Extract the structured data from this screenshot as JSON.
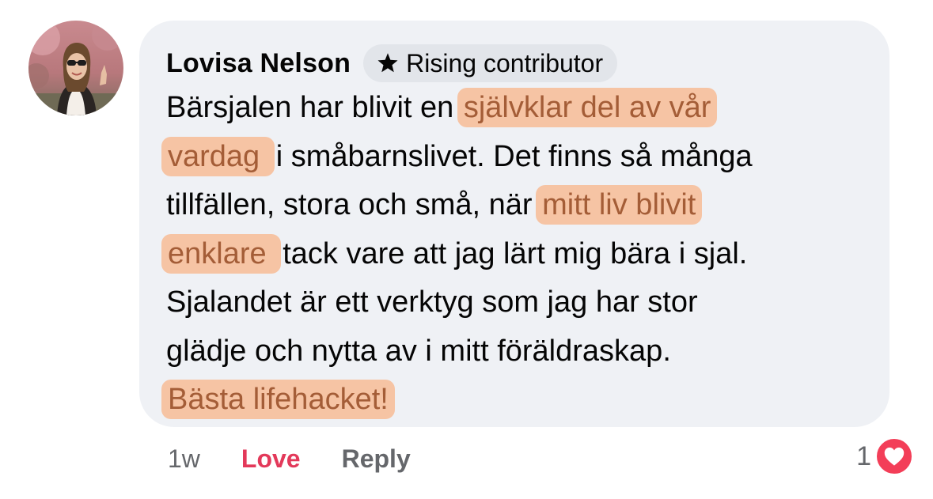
{
  "comment": {
    "author": {
      "name": "Lovisa Nelson",
      "badge_icon": "star-icon",
      "badge_label": "Rising contributor"
    },
    "lines": [
      [
        {
          "text": "Bärsjalen har blivit en "
        },
        {
          "text": "självklar del av vår",
          "highlight": true
        }
      ],
      [
        {
          "text": "vardag ",
          "highlight": true
        },
        {
          "text": "i småbarnslivet. Det finns så många"
        }
      ],
      [
        {
          "text": "tillfällen, stora och små, när "
        },
        {
          "text": "mitt liv blivit",
          "highlight": true
        }
      ],
      [
        {
          "text": "enklare ",
          "highlight": true
        },
        {
          "text": "tack vare att jag lärt mig bära i sjal."
        }
      ],
      [
        {
          "text": "Sjalandet är ett verktyg som jag har stor"
        }
      ],
      [
        {
          "text": "glädje och nytta av i mitt föräldraskap."
        }
      ],
      [
        {
          "text": "Bästa lifehacket!",
          "highlight": true
        }
      ]
    ],
    "highlight_color": "#f6c4a4",
    "highlight_text_color": "#a45d37"
  },
  "actions": {
    "timestamp": "1w",
    "love_label": "Love",
    "reply_label": "Reply",
    "love_color": "#e3395a"
  },
  "reactions": {
    "count": "1",
    "icon": "heart-icon",
    "color": "#f33e58"
  }
}
